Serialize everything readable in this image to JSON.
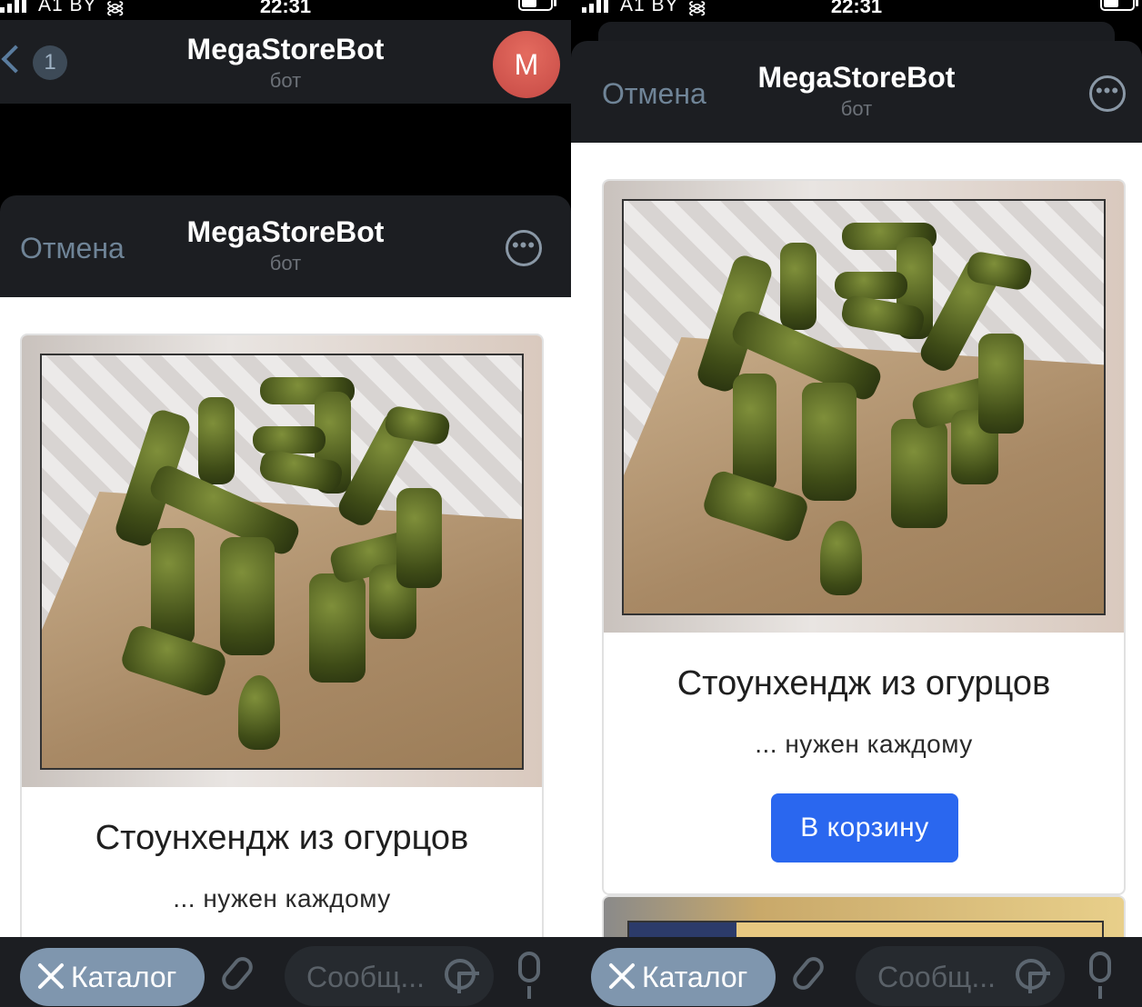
{
  "status_bar": {
    "carrier": "A1 BY",
    "time": "22:31"
  },
  "chat_header": {
    "back_count": "1",
    "title": "MegaStoreBot",
    "subtitle": "бот",
    "avatar_letter": "M"
  },
  "webapp_header": {
    "cancel_label": "Отмена",
    "title": "MegaStoreBot",
    "subtitle": "бот"
  },
  "product": {
    "name": "Стоунхендж из огурцов",
    "description": "... нужен каждому",
    "add_to_cart_label": "В корзину"
  },
  "bottom_bar": {
    "menu_button_label": "Каталог",
    "message_placeholder": "Сообщ..."
  },
  "colors": {
    "header_bg": "#1c1e22",
    "accent_button": "#2a67ef",
    "menu_button": "#7f96ae",
    "avatar": "#d9584f"
  },
  "icons": [
    "signal-icon",
    "wifi-icon",
    "battery-icon",
    "back-chevron-icon",
    "more-icon",
    "close-icon",
    "paperclip-icon",
    "sticker-icon",
    "microphone-icon"
  ]
}
